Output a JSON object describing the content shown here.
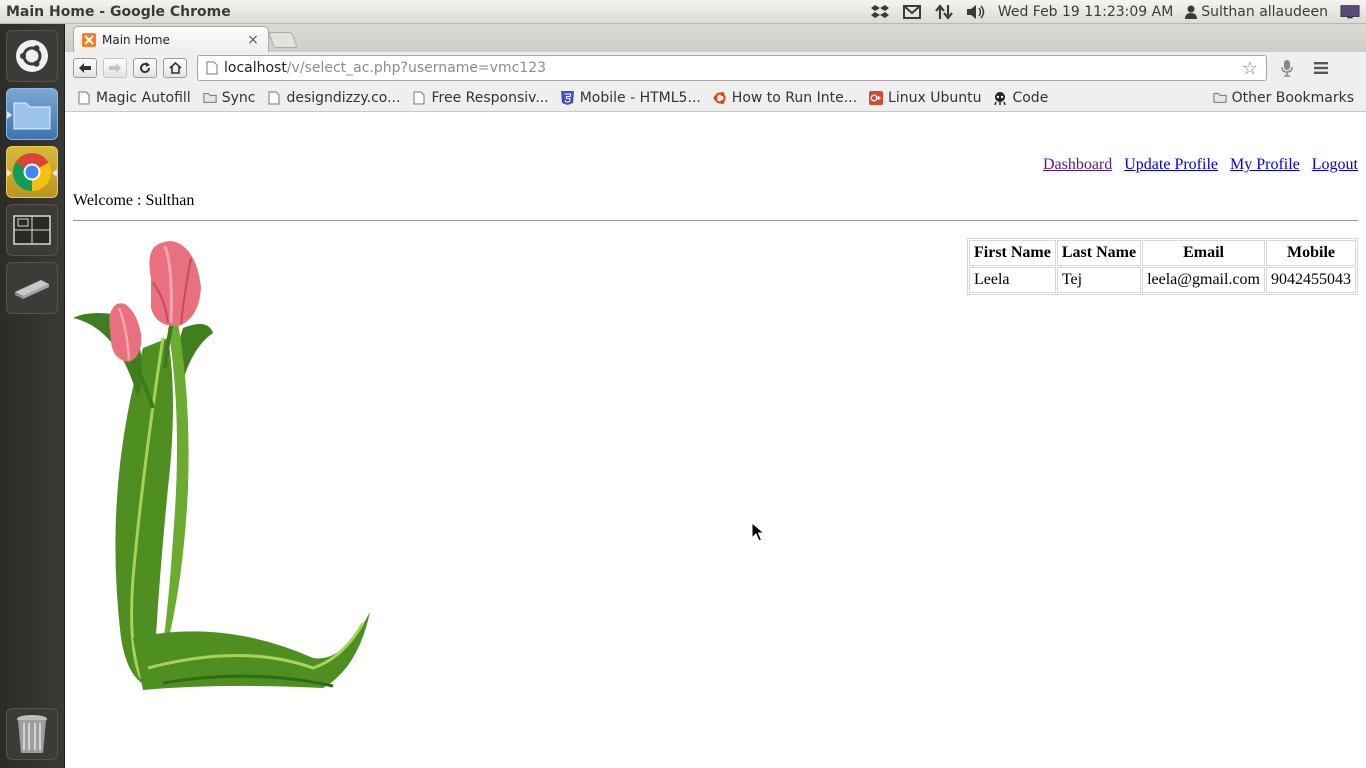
{
  "panel": {
    "window_title": "Main Home - Google Chrome",
    "clock": "Wed Feb 19 11:23:09 AM",
    "user": "Sulthan allaudeen"
  },
  "browser": {
    "tab_title": "Main Home",
    "tab_close": "×",
    "url_host": "localhost",
    "url_path": "/v/select_ac.php?username=vmc123",
    "bookmarks": [
      {
        "label": "Magic Autofill",
        "icon": "page-icon"
      },
      {
        "label": "Sync",
        "icon": "folder-icon"
      },
      {
        "label": "designdizzy.co...",
        "icon": "page-icon"
      },
      {
        "label": "Free Responsiv...",
        "icon": "page-icon"
      },
      {
        "label": "Mobile - HTML5...",
        "icon": "html5-icon"
      },
      {
        "label": "How to Run Inte...",
        "icon": "ubuntu-icon"
      },
      {
        "label": "Linux Ubuntu",
        "icon": "google-plus-icon"
      },
      {
        "label": "Code",
        "icon": "code-icon"
      }
    ],
    "other_bookmarks": "Other Bookmarks"
  },
  "page": {
    "nav": {
      "dashboard": "Dashboard",
      "update_profile": "Update Profile",
      "my_profile": "My Profile",
      "logout": "Logout"
    },
    "welcome": "Welcome : Sulthan",
    "table": {
      "headers": [
        "First Name",
        "Last Name",
        "Email",
        "Mobile"
      ],
      "rows": [
        [
          "Leela",
          "Tej",
          "leela@gmail.com",
          "9042455043"
        ]
      ]
    }
  },
  "colors": {
    "link": "#0000ee",
    "visited_link": "#551a8b",
    "launcher_bg": "#2c2b28",
    "tulip_pink": "#e8707f",
    "leaf_green": "#5a9a2a"
  }
}
